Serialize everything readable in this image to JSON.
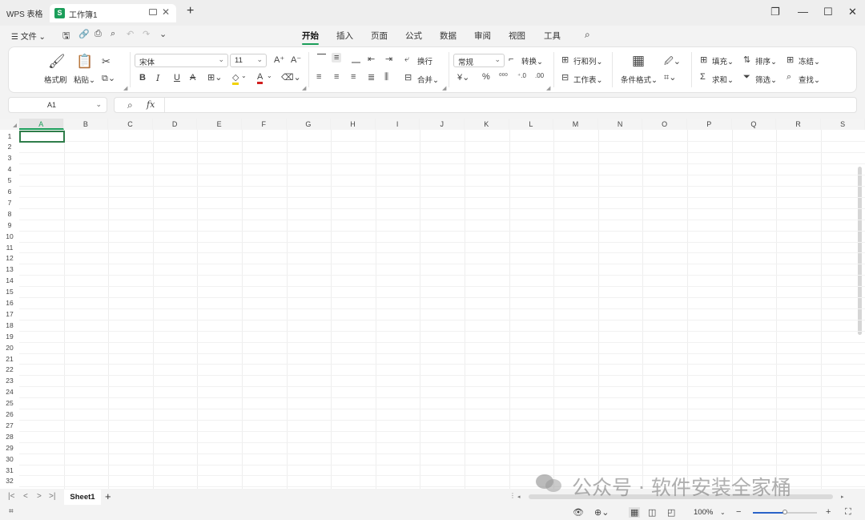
{
  "titlebar": {
    "app_name": "WPS 表格",
    "doc_tab": {
      "icon_letter": "S",
      "name": "工作簿1"
    },
    "new_tab": "+",
    "window_buttons": [
      "❐",
      "—",
      "☐",
      "✕"
    ]
  },
  "menu": {
    "file": "☰ 文件 ⌄",
    "tabs": [
      "开始",
      "插入",
      "页面",
      "公式",
      "数据",
      "审阅",
      "视图",
      "工具"
    ],
    "active_tab": "开始"
  },
  "ribbon": {
    "format_painter": "格式刷",
    "paste": "粘贴⌄",
    "font_name": "宋体",
    "font_size": "11",
    "wrap": "换行",
    "merge": "合并⌄",
    "number_format": "常规",
    "convert": "转换⌄",
    "row_col": "行和列⌄",
    "worksheet": "工作表⌄",
    "cond_format": "条件格式⌄",
    "fill": "填充⌄",
    "sort": "排序⌄",
    "freeze": "冻结⌄",
    "sum": "求和⌄",
    "filter": "筛选⌄",
    "find": "查找⌄",
    "accent_color": "#1b9e5a"
  },
  "formula_bar": {
    "cell_ref": "A1",
    "fx": "fx",
    "value": ""
  },
  "grid": {
    "columns": [
      "A",
      "B",
      "C",
      "D",
      "E",
      "F",
      "G",
      "H",
      "I",
      "J",
      "K",
      "L",
      "M",
      "N",
      "O",
      "P",
      "Q",
      "R",
      "S"
    ],
    "rows": [
      "1",
      "2",
      "3",
      "4",
      "5",
      "6",
      "7",
      "8",
      "9",
      "10",
      "11",
      "12",
      "13",
      "14",
      "15",
      "16",
      "17",
      "18",
      "19",
      "20",
      "21",
      "22",
      "23",
      "24",
      "25",
      "26",
      "27",
      "28",
      "29",
      "30",
      "31",
      "32"
    ],
    "selected_cell": "A1"
  },
  "sheets": {
    "nav": [
      "|<",
      "<",
      ">",
      ">|"
    ],
    "tabs": [
      "Sheet1"
    ],
    "add": "+"
  },
  "status": {
    "zoom": "100%",
    "zoom_level": 0.5
  },
  "watermark": "公众号 · 软件安装全家桶"
}
